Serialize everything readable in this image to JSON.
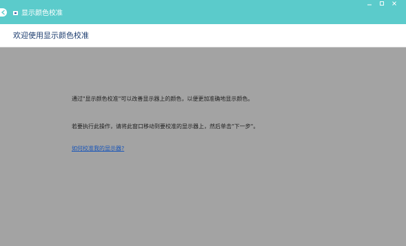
{
  "window": {
    "title": "显示颜色校准",
    "icons": {
      "back": "back-arrow-icon",
      "app": "display-color-calibration-icon",
      "minimize": "minimize-icon",
      "maximize": "maximize-icon",
      "close": "close-icon"
    },
    "colors": {
      "titlebar": "#5bcbcb",
      "content_bg": "#a3a3a3",
      "header_text": "#1a3b6e",
      "link": "#1a56b8"
    }
  },
  "header": {
    "title": "欢迎使用显示颜色校准"
  },
  "main": {
    "paragraph1": "通过\"显示颜色校准\"可以改善显示器上的颜色，以便更加准确地显示颜色。",
    "paragraph2": "若要执行此操作，请将此窗口移动到要校准的显示器上，然后单击\"下一步\"。",
    "help_link": "如何校准我的显示器?"
  }
}
